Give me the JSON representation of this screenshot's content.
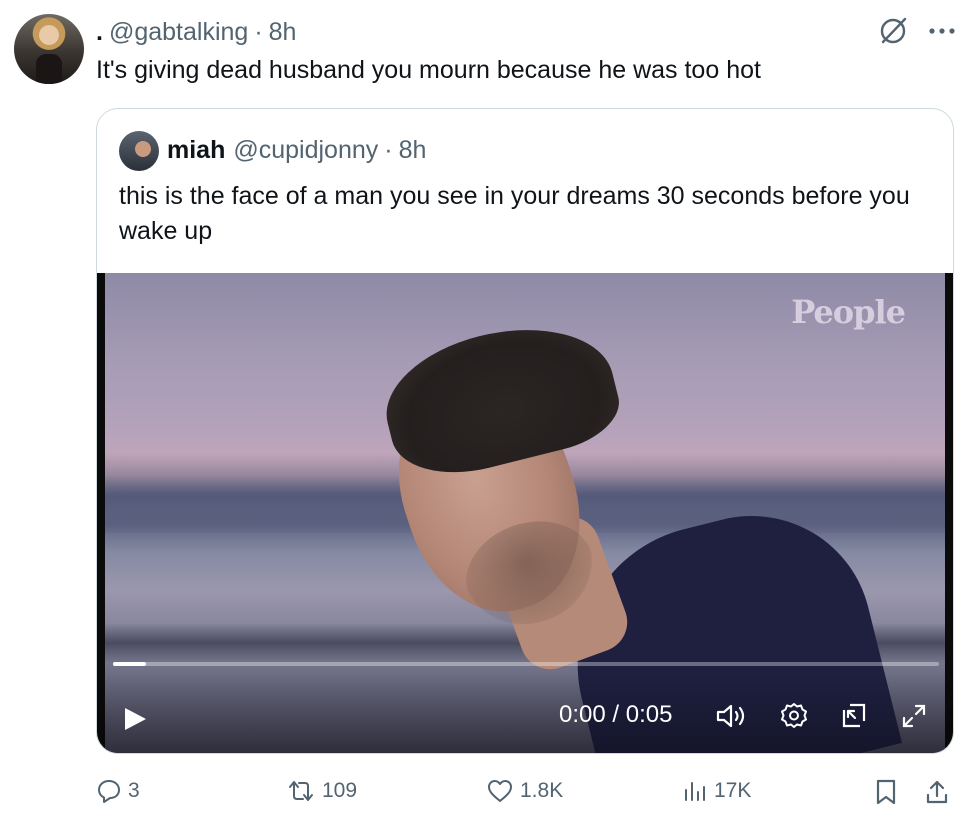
{
  "post": {
    "display_name": ".",
    "handle": "@gabtalking",
    "separator": "·",
    "time": "8h",
    "text": "It's giving dead husband you mourn because he was too hot"
  },
  "quote": {
    "display_name": "miah",
    "handle": "@cupidjonny",
    "separator": "·",
    "time": "8h",
    "text": "this is the face of a man you see in your dreams 30 seconds before you wake up"
  },
  "video": {
    "watermark": "People",
    "time_display": "0:00 / 0:05",
    "progress_fraction": 0.04
  },
  "actions": {
    "replies": "3",
    "reposts": "109",
    "likes": "1.8K",
    "views": "17K"
  },
  "icons": {
    "grok": "no-entry-circle-icon",
    "more": "more-icon",
    "reply": "reply-icon",
    "repost": "repost-icon",
    "like": "heart-icon",
    "views": "views-icon",
    "bookmark": "bookmark-icon",
    "share": "share-icon",
    "play": "play-icon",
    "volume": "volume-icon",
    "settings": "settings-icon",
    "pip": "picture-in-picture-icon",
    "fullscreen": "fullscreen-icon"
  }
}
